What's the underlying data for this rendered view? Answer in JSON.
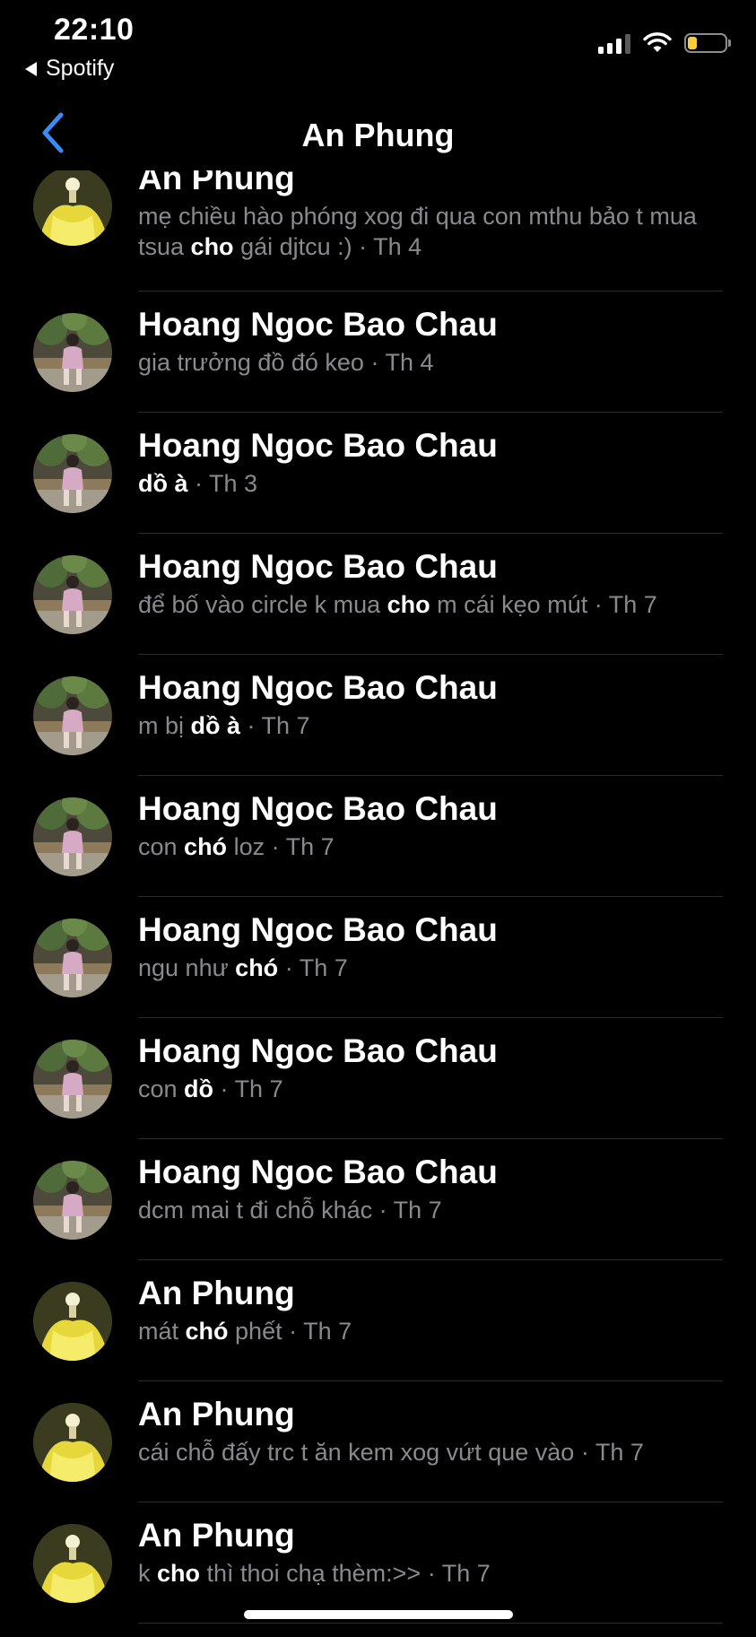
{
  "status_bar": {
    "time": "22:10",
    "back_app": "Spotify",
    "battery_color": "#f7cf3a"
  },
  "nav": {
    "title": "An Phung",
    "back_icon": "chevron-left-icon",
    "accent": "#3a8cf5"
  },
  "results": [
    {
      "name": "An Phung",
      "avatar": "yellow",
      "parts": [
        [
          "mẹ chiều hào phóng xog đi qua con mthu bảo t mua tsua ",
          false
        ],
        [
          "cho",
          true
        ],
        [
          " gái djtcu :)",
          false
        ]
      ],
      "date": "Th 4"
    },
    {
      "name": "Hoang Ngoc Bao Chau",
      "avatar": "photo",
      "parts": [
        [
          "gia trưởng đồ đó keo",
          false
        ]
      ],
      "date": "Th 4"
    },
    {
      "name": "Hoang Ngoc Bao Chau",
      "avatar": "photo",
      "parts": [
        [
          "dồ à",
          true
        ]
      ],
      "date": "Th 3"
    },
    {
      "name": "Hoang Ngoc Bao Chau",
      "avatar": "photo",
      "parts": [
        [
          "để bố vào circle k mua ",
          false
        ],
        [
          "cho",
          true
        ],
        [
          " m cái kẹo mút",
          false
        ]
      ],
      "date": "Th 7"
    },
    {
      "name": "Hoang Ngoc Bao Chau",
      "avatar": "photo",
      "parts": [
        [
          "m bị ",
          false
        ],
        [
          "dồ à",
          true
        ]
      ],
      "date": "Th 7"
    },
    {
      "name": "Hoang Ngoc Bao Chau",
      "avatar": "photo",
      "parts": [
        [
          "con ",
          false
        ],
        [
          "chó",
          true
        ],
        [
          " loz",
          false
        ]
      ],
      "date": "Th 7"
    },
    {
      "name": "Hoang Ngoc Bao Chau",
      "avatar": "photo",
      "parts": [
        [
          "ngu như ",
          false
        ],
        [
          "chó",
          true
        ]
      ],
      "date": "Th 7"
    },
    {
      "name": "Hoang Ngoc Bao Chau",
      "avatar": "photo",
      "parts": [
        [
          "con ",
          false
        ],
        [
          "dồ",
          true
        ]
      ],
      "date": "Th 7"
    },
    {
      "name": "Hoang Ngoc Bao Chau",
      "avatar": "photo",
      "parts": [
        [
          "dcm mai t đi chỗ khác",
          false
        ]
      ],
      "date": "Th 7"
    },
    {
      "name": "An Phung",
      "avatar": "yellow",
      "parts": [
        [
          "mát ",
          false
        ],
        [
          "chó",
          true
        ],
        [
          " phết",
          false
        ]
      ],
      "date": "Th 7"
    },
    {
      "name": "An Phung",
      "avatar": "yellow",
      "parts": [
        [
          "cái chỗ đấy trc t ăn kem xog vứt que vào",
          false
        ]
      ],
      "date": "Th 7"
    },
    {
      "name": "An Phung",
      "avatar": "yellow",
      "parts": [
        [
          "k ",
          false
        ],
        [
          "cho",
          true
        ],
        [
          " thì thoi chạ thèm:>>",
          false
        ]
      ],
      "date": "Th 7"
    }
  ]
}
